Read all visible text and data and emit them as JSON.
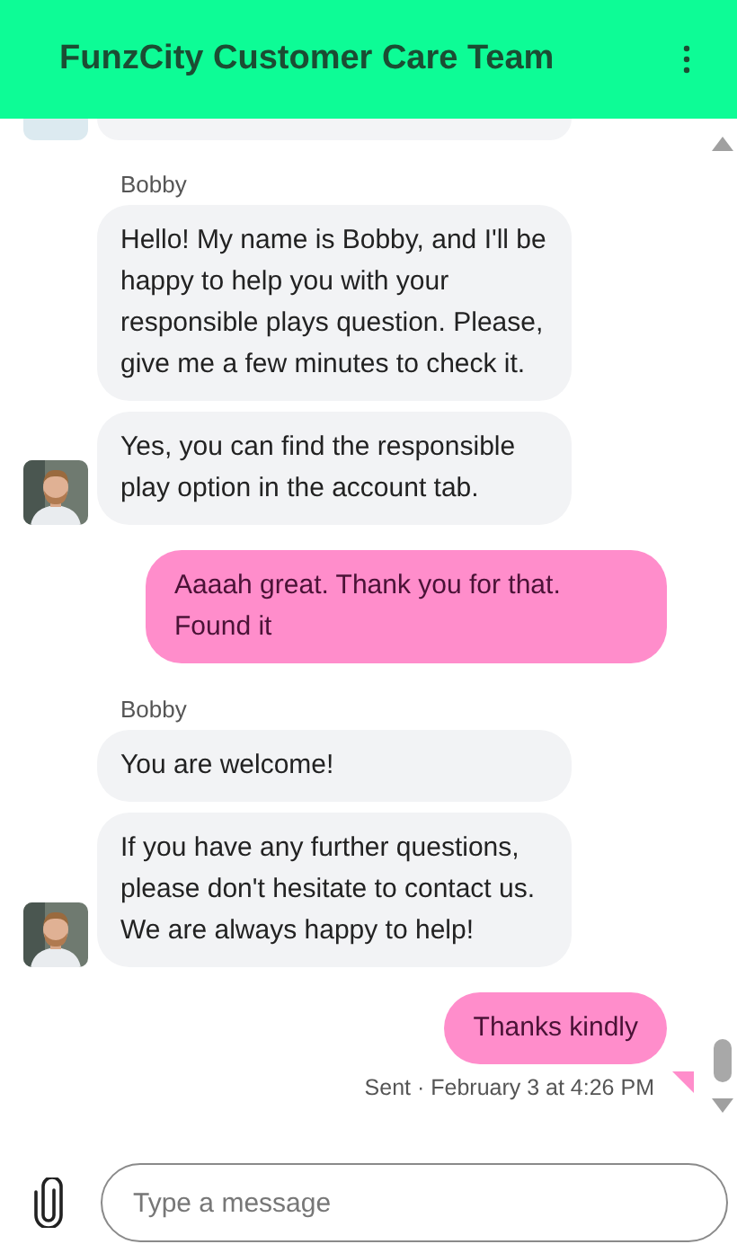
{
  "header": {
    "title": "FunzCity Customer Care Team"
  },
  "messages": [
    {
      "kind": "agent",
      "sender": "Bobby",
      "bubbles": [
        "Hello! My name is Bobby, and I'll be happy to help you with your responsible plays question. Please, give me a few minutes to check it.",
        "Yes, you can find the responsible play option in the account tab."
      ]
    },
    {
      "kind": "outgoing",
      "text": "Aaaah great. Thank you for that. Found it"
    },
    {
      "kind": "agent",
      "sender": "Bobby",
      "bubbles": [
        "You are welcome!",
        "If you have any further questions, please don't hesitate to contact us. We are always happy to help!"
      ]
    },
    {
      "kind": "outgoing",
      "text": "Thanks kindly",
      "status": "Sent · February 3 at 4:26 PM"
    }
  ],
  "composer": {
    "placeholder": "Type a message"
  }
}
